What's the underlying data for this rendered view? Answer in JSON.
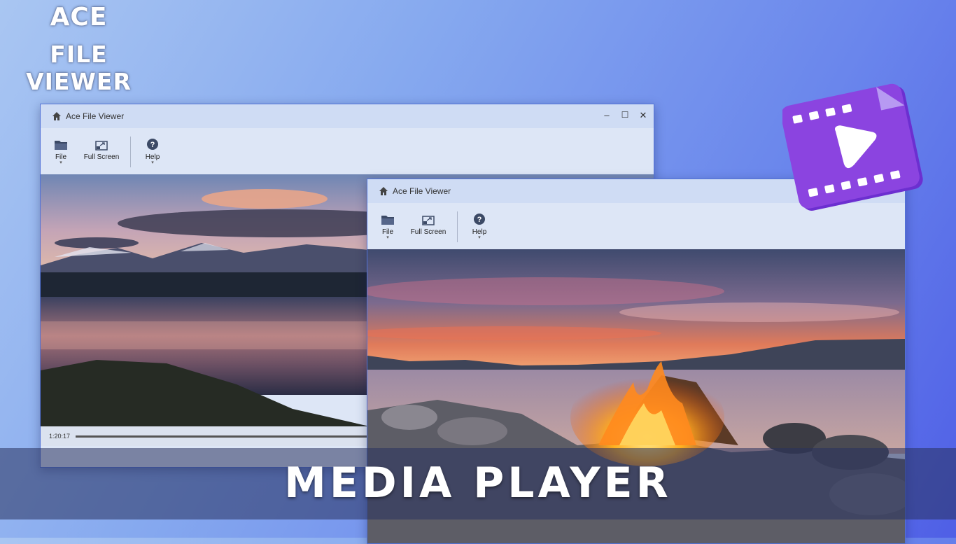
{
  "brand": {
    "line1": "ACE",
    "line2": "FILE VIEWER"
  },
  "window_back": {
    "title": "Ace File Viewer",
    "controls": {
      "minimize": "–",
      "maximize": "☐",
      "close": "✕"
    },
    "toolbar": {
      "file_label": "File",
      "fullscreen_label": "Full Screen",
      "help_label": "Help"
    },
    "player": {
      "timestamp": "1:20:17"
    }
  },
  "window_front": {
    "title": "Ace File Viewer",
    "controls": {
      "close": "✕"
    },
    "toolbar": {
      "file_label": "File",
      "fullscreen_label": "Full Screen",
      "help_label": "Help"
    }
  },
  "banner": {
    "text": "MEDIA PLAYER"
  },
  "icons": {
    "home": "home-icon",
    "folder": "folder-icon",
    "fullscreen": "fullscreen-icon",
    "help": "help-icon",
    "app_logo": "video-file-icon"
  },
  "colors": {
    "accent": "#5273d8",
    "logo": "#8b44e0"
  }
}
